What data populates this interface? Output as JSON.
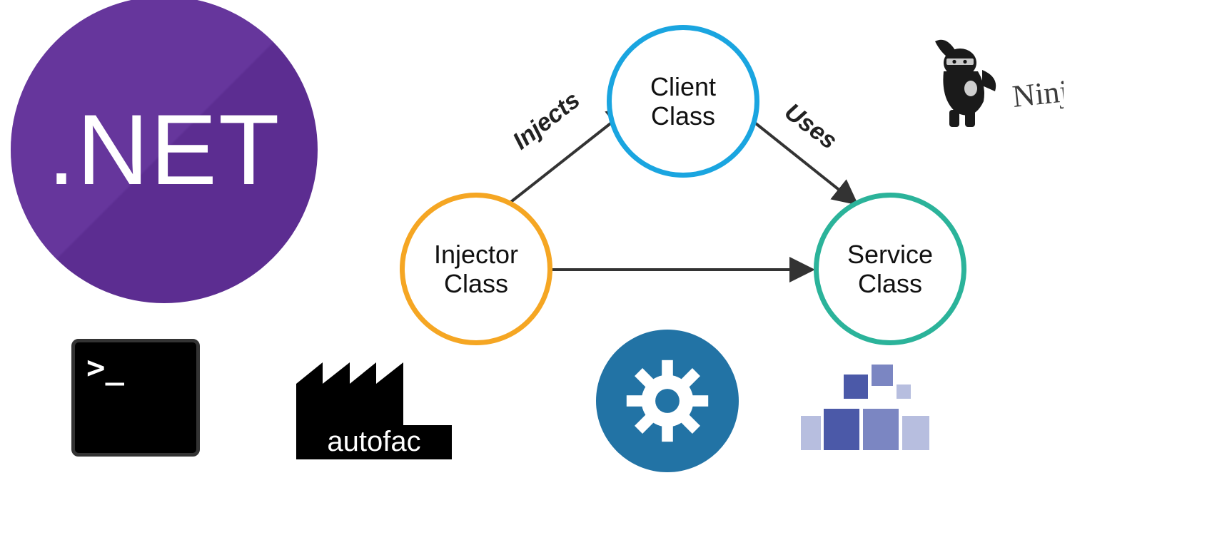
{
  "logos": {
    "dotnet_text": ".NET",
    "autofac_label": "autofac",
    "terminal_prompt": ">_",
    "ninject_label": "Ninject!"
  },
  "diagram": {
    "nodes": {
      "injector": {
        "line1": "Injector",
        "line2": "Class",
        "color": "#f5a623"
      },
      "client": {
        "line1": "Client",
        "line2": "Class",
        "color": "#1aa5e0"
      },
      "service": {
        "line1": "Service",
        "line2": "Class",
        "color": "#2bb39a"
      }
    },
    "edges": {
      "injects": {
        "label": "Injects",
        "from": "injector",
        "to": "client"
      },
      "uses": {
        "label": "Uses",
        "from": "client",
        "to": "service"
      },
      "creates": {
        "label": "",
        "from": "injector",
        "to": "service"
      }
    }
  },
  "icons": {
    "gear": "gear-icon",
    "terminal": "terminal-icon",
    "castle": "castle-icon",
    "ninja": "ninja-icon"
  }
}
